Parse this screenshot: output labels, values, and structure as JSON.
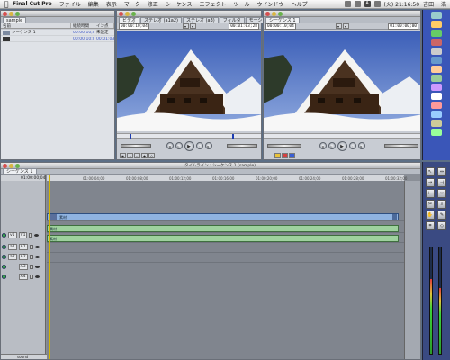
{
  "menubar": {
    "apple_icon": "apple-icon",
    "app": "Final Cut Pro",
    "items": [
      "ファイル",
      "編集",
      "表示",
      "マーク",
      "修正",
      "シーケンス",
      "エフェクト",
      "ツール",
      "ウインドウ",
      "ヘルプ"
    ],
    "clock": "(火) 21:16:50",
    "user": "吉田 一浩"
  },
  "browser": {
    "tabs": [
      "sample"
    ],
    "columns": [
      "名前",
      "継続時間",
      "イン点"
    ],
    "rows": [
      {
        "name": "シーケンス 1",
        "duration": "00:00:10;04",
        "in": "未設定"
      },
      {
        "name": "",
        "duration": "00:00:10;04",
        "in": "00:01:03:"
      }
    ]
  },
  "viewer": {
    "tabs": [
      "ビデオ",
      "ステレオ (a1a2)",
      "ステレオ (a3)",
      "フィルタ",
      "モーション"
    ],
    "tc_left": "00:00:10;04",
    "tc_right": "00:01:03;28"
  },
  "canvas": {
    "tabs": [
      "シーケンス 1"
    ],
    "tc_left": "00:00:10;04",
    "tc_right": "01:00:00;00"
  },
  "timeline": {
    "title": "タイムライン : シーケンス 1 (sample)",
    "tabs": [
      "シーケンス 1"
    ],
    "timecode": "01:00:00;04",
    "ruler": [
      "01:00:04;00",
      "01:00:08;00",
      "01:00:12;00",
      "01:00:16;00",
      "01:00:20;00",
      "01:00:24;00",
      "01:00:28;00",
      "01:00:32;00"
    ],
    "tracks": [
      {
        "src": "v1",
        "dst": "V1",
        "kind": "video"
      },
      {
        "src": "a1",
        "dst": "A1",
        "kind": "audio"
      },
      {
        "src": "a2",
        "dst": "A2",
        "kind": "audio"
      },
      {
        "src": "",
        "dst": "A3",
        "kind": "empty"
      },
      {
        "src": "",
        "dst": "A4",
        "kind": "empty"
      }
    ],
    "clips": {
      "v1": "素材",
      "a1": "素材",
      "a2": "素材"
    },
    "zoom_label": "sound"
  },
  "colors": {
    "accent": "#3a56b8",
    "video_clip": "#8fb3e0",
    "audio_clip": "#9ed19e",
    "playhead": "#d4b400"
  }
}
